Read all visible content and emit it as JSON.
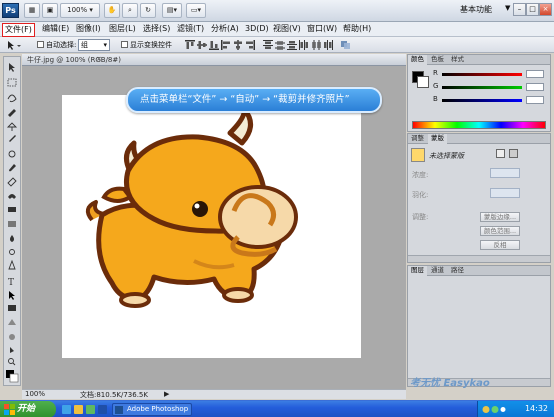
{
  "app": {
    "logo_text": "Ps",
    "zoom_value": "100%",
    "workspace_label": "基本功能",
    "workspace_arrow": "▼",
    "window_buttons": [
      "–",
      "□",
      "×"
    ]
  },
  "menu": {
    "items": [
      "文件(F)",
      "编辑(E)",
      "图像(I)",
      "图层(L)",
      "选择(S)",
      "滤镜(T)",
      "分析(A)",
      "3D(D)",
      "视图(V)",
      "窗口(W)",
      "帮助(H)"
    ],
    "highlight_color": "#e02020"
  },
  "options": {
    "auto_select_label": "自动选择:",
    "auto_select_value": "组",
    "show_transform_label": "显示变换控件"
  },
  "document": {
    "tab_title": "牛仔.jpg @ 100% (RGB/8#)",
    "callout_text": "点击菜单栏“文件” → “自动” → “裁剪并修齐照片”",
    "status_zoom": "100%",
    "status_doc": "文档:810.5K/736.5K",
    "canvas_bg": "#ffffff",
    "workspace_bg": "#aaaaaa",
    "callout_color": "#2b7fd6"
  },
  "color_panel": {
    "tabs": [
      "颜色",
      "色板",
      "样式"
    ],
    "channels": [
      "R",
      "G",
      "B"
    ]
  },
  "adjust_panel": {
    "tabs": [
      "调整",
      "蒙版"
    ],
    "mask_label": "未选择蒙版",
    "density_label": "浓度:",
    "feather_label": "羽化:",
    "refine_label": "调整:",
    "buttons": [
      "蒙版边缘...",
      "颜色范围...",
      "反相"
    ]
  },
  "layers_panel": {
    "tabs": [
      "图层",
      "通道",
      "路径"
    ]
  },
  "taskbar": {
    "start_label": "开始",
    "task_label": "Adobe Photoshop ...",
    "time": "14:32",
    "start_color": "#2f8f2c"
  },
  "watermark": "考无忧 Easykao"
}
